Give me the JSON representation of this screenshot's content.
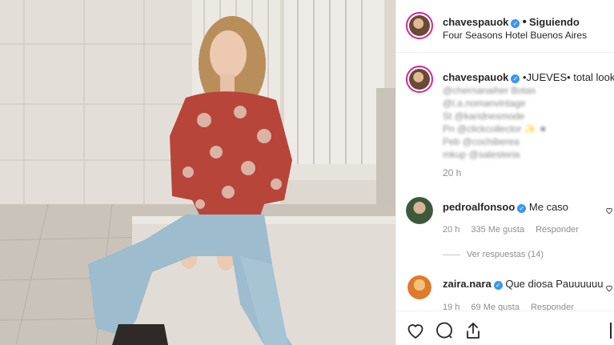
{
  "post": {
    "author": "chavespauok",
    "follow_status": "Siguiendo",
    "location": "Four Seasons Hotel Buenos Aires",
    "caption_user": "chavespauok",
    "caption_first_line": "•JUEVES• total look",
    "caption_lines_blurred": [
      "@chernanaiher Botas",
      "@l.a.nomanvintage",
      "St @karidnesmode",
      "Pn @clickcollector ✨ ★",
      "Peb @cochiberea",
      "mkup @salesteria"
    ],
    "caption_time": "20 h"
  },
  "comments": [
    {
      "user": "pedroalfonsoo",
      "text": "Me caso",
      "time": "20 h",
      "likes": "335 Me gusta",
      "reply_label": "Responder",
      "view_replies": "Ver respuestas (14)"
    },
    {
      "user": "zaira.nara",
      "text": "Que diosa Pauuuuuu",
      "time": "19 h",
      "likes": "69 Me gusta",
      "reply_label": "Responder"
    }
  ],
  "icons": {
    "like": "heart-icon",
    "comment": "comment-icon",
    "share": "share-icon",
    "verified": "verified-badge-icon"
  },
  "colors": {
    "verified": "#3897f0",
    "story_ring": "#d6249f",
    "secondary_text": "#8e8e8e"
  }
}
